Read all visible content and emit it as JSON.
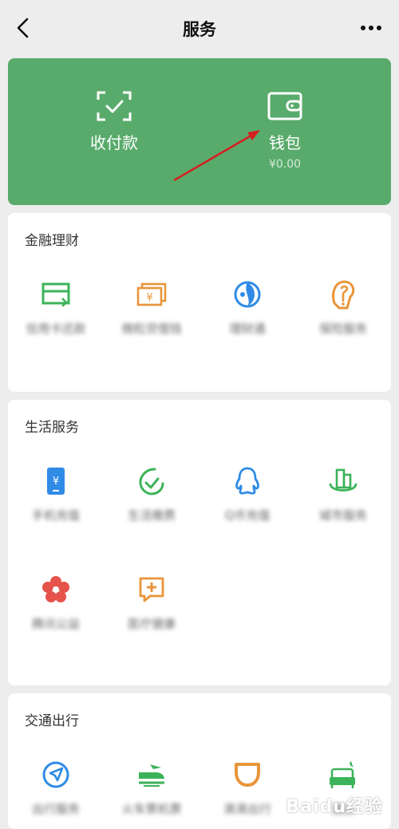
{
  "header": {
    "title": "服务"
  },
  "hero": {
    "pay": {
      "label": "收付款"
    },
    "wallet": {
      "label": "钱包",
      "balance": "¥0.00"
    }
  },
  "finance": {
    "title": "金融理财",
    "items": [
      {
        "label": "信用卡还款",
        "icon": "credit-card-icon",
        "color": "#3cb35a"
      },
      {
        "label": "微粒贷借钱",
        "icon": "loan-icon",
        "color": "#e8953a"
      },
      {
        "label": "理财通",
        "icon": "wealth-icon",
        "color": "#2f8be6"
      },
      {
        "label": "保险服务",
        "icon": "insurance-icon",
        "color": "#e8953a"
      }
    ]
  },
  "life": {
    "title": "生活服务",
    "items": [
      {
        "label": "手机充值",
        "icon": "phone-recharge-icon",
        "color": "#2f8be6"
      },
      {
        "label": "生活缴费",
        "icon": "utility-icon",
        "color": "#3cb35a"
      },
      {
        "label": "Q币充值",
        "icon": "qq-icon",
        "color": "#2f8be6"
      },
      {
        "label": "城市服务",
        "icon": "city-icon",
        "color": "#3cb35a"
      },
      {
        "label": "腾讯公益",
        "icon": "charity-flower-icon",
        "color": "#e5534b"
      },
      {
        "label": "医疗健康",
        "icon": "medical-icon",
        "color": "#e8953a"
      }
    ]
  },
  "transport": {
    "title": "交通出行",
    "items": [
      {
        "label": "出行服务",
        "icon": "navigation-icon",
        "color": "#2f8be6"
      },
      {
        "label": "火车票机票",
        "icon": "train-icon",
        "color": "#3cb35a"
      },
      {
        "label": "滴滴出行",
        "icon": "didi-icon",
        "color": "#e8953a"
      },
      {
        "label": "酒店",
        "icon": "hotel-icon",
        "color": "#3cb35a"
      }
    ]
  },
  "watermark": "Baidu经验"
}
